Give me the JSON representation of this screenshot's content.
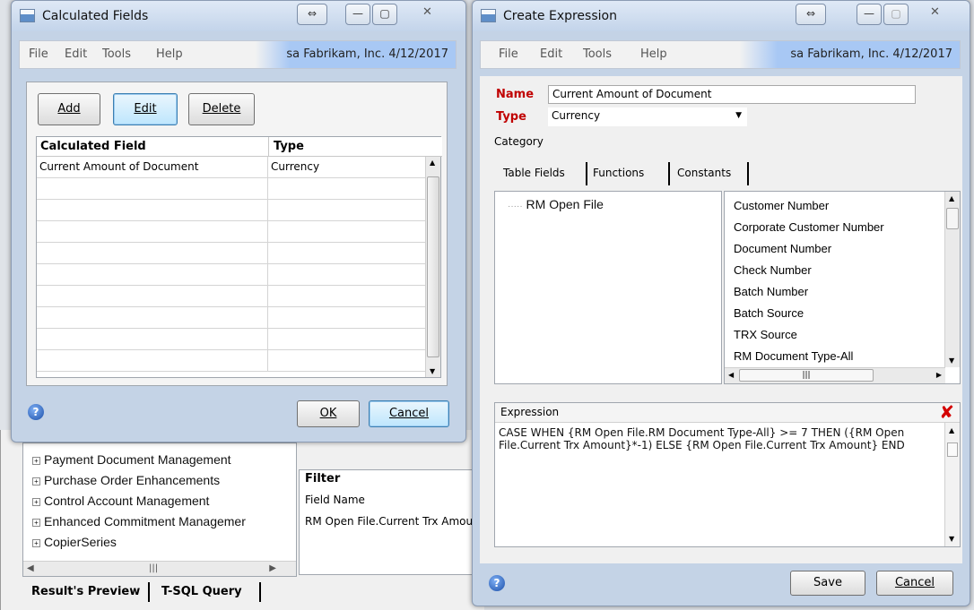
{
  "calc_window": {
    "title": "Calculated Fields",
    "menus": [
      "File",
      "Edit",
      "Tools",
      "Help"
    ],
    "user_info": "sa  Fabrikam, Inc.  4/12/2017",
    "buttons": {
      "add": "Add",
      "edit": "Edit",
      "delete": "Delete",
      "ok": "OK",
      "cancel": "Cancel"
    },
    "columns": [
      "Calculated Field",
      "Type"
    ],
    "rows": [
      {
        "field": "Current Amount of Document",
        "type": "Currency"
      }
    ]
  },
  "expr_window": {
    "title": "Create Expression",
    "menus": [
      "File",
      "Edit",
      "Tools",
      "Help"
    ],
    "user_info": "sa  Fabrikam, Inc.  4/12/2017",
    "name_label": "Name",
    "name_value": "Current Amount of Document",
    "type_label": "Type",
    "type_value": "Currency",
    "category_label": "Category",
    "tabs": [
      "Table Fields",
      "Functions",
      "Constants"
    ],
    "tree_item": "RM Open File",
    "fields": [
      "Customer Number",
      "Corporate Customer Number",
      "Document Number",
      "Check Number",
      "Batch Number",
      "Batch Source",
      "TRX Source",
      "RM Document Type-All"
    ],
    "expression_label": "Expression",
    "expression_text": "CASE WHEN {RM Open File.RM Document Type-All} >= 7 THEN ({RM Open File.Current Trx Amount}*-1) ELSE {RM Open File.Current Trx Amount} END",
    "save": "Save",
    "cancel": "Cancel"
  },
  "background": {
    "tree_items": [
      "Payment Document Management",
      "Purchase Order Enhancements",
      "Control Account Management",
      "Enhanced Commitment Managemer",
      "CopierSeries"
    ],
    "filter_header": "Filter",
    "field_name_label": "Field Name",
    "field_name_value": "RM Open File.Current Trx Amou",
    "tabs": [
      "Result's Preview",
      "T-SQL Query"
    ]
  }
}
